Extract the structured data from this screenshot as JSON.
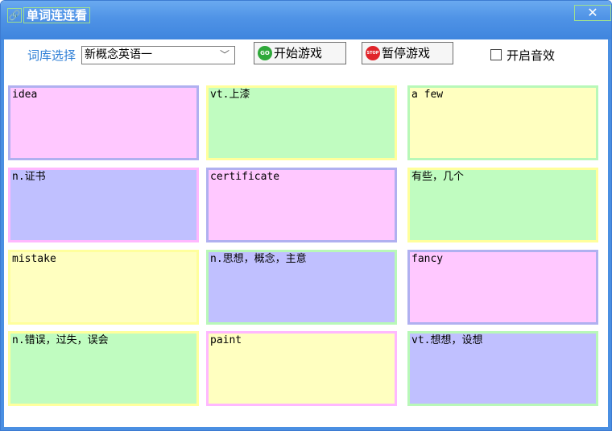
{
  "window": {
    "title": "单词连连看",
    "close_label": "✕"
  },
  "toolbar": {
    "library_label": "词库选择",
    "library_selected": "新概念英语一",
    "start_label": "开始游戏",
    "start_icon_text": "GO",
    "pause_label": "暂停游戏",
    "pause_icon_text": "STOP",
    "sound_label": "开启音效",
    "sound_checked": false
  },
  "colors": {
    "pink": "#ffc8ff",
    "green": "#c0fcc0",
    "yellow": "#ffffc0",
    "blue": "#c0c0ff",
    "accent": "#2f7fd6"
  },
  "cards": [
    {
      "text": "idea",
      "color": "pink"
    },
    {
      "text": "vt.上漆",
      "color": "green"
    },
    {
      "text": "a few",
      "color": "yellow"
    },
    {
      "text": "n.证书",
      "color": "blue"
    },
    {
      "text": "certificate",
      "color": "pink"
    },
    {
      "text": "有些，几个",
      "color": "green"
    },
    {
      "text": "mistake",
      "color": "yellow"
    },
    {
      "text": "n.思想，概念，主意",
      "color": "blue"
    },
    {
      "text": "fancy",
      "color": "pink"
    },
    {
      "text": "n.错误，过失，误会",
      "color": "green"
    },
    {
      "text": "paint",
      "color": "yellow"
    },
    {
      "text": "vt.想想，设想",
      "color": "blue"
    }
  ]
}
